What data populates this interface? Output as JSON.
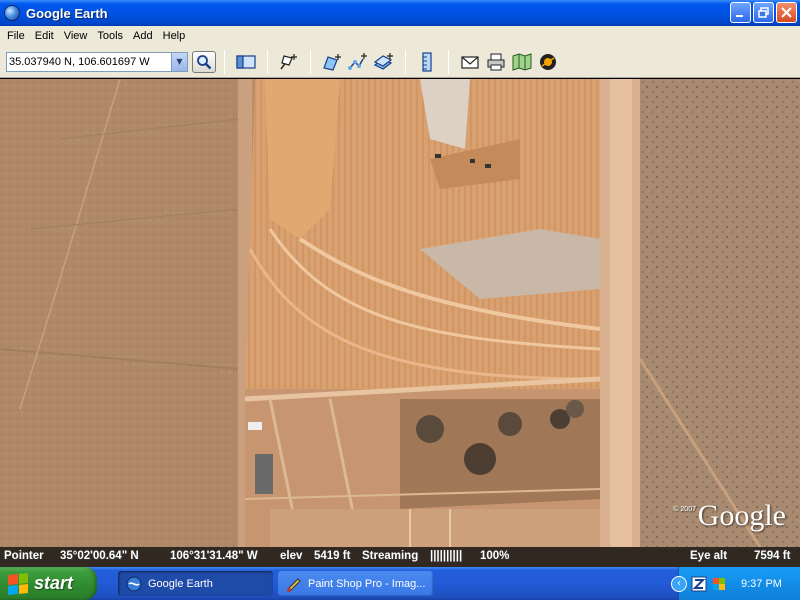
{
  "window": {
    "title": "Google Earth"
  },
  "menu": {
    "items": [
      "File",
      "Edit",
      "View",
      "Tools",
      "Add",
      "Help"
    ]
  },
  "toolbar": {
    "search": {
      "value": "35.037940 N, 106.601697 W"
    },
    "icons": [
      "search-icon",
      "sidebar-toggle-icon",
      "placemark-add-icon",
      "polygon-add-icon",
      "path-add-icon",
      "image-overlay-add-icon",
      "ruler-icon",
      "email-icon",
      "print-icon",
      "google-maps-icon",
      "sky-toggle-icon"
    ]
  },
  "status": {
    "pointer_label": "Pointer",
    "lat": "35°02'00.64\" N",
    "lon": "106°31'31.48\" W",
    "elev_label": "elev",
    "elev_value": "5419 ft",
    "streaming_label": "Streaming",
    "streaming_bar": "||||||||||",
    "streaming_percent": "100%",
    "eye_alt_label": "Eye alt",
    "eye_alt_value": "7594 ft"
  },
  "map": {
    "watermark": "Google",
    "copyright": "© 2007"
  },
  "taskbar": {
    "start_label": "start",
    "tasks": [
      {
        "label": "Google Earth",
        "active": true
      },
      {
        "label": "Paint Shop Pro - Imag...",
        "active": false
      }
    ],
    "clock": "9:37 PM"
  },
  "colors": {
    "titlebar": "#0058ee",
    "menubar": "#ece9d8",
    "taskbar": "#245edb",
    "start_button": "#3c9c3c",
    "tray": "#128de8"
  }
}
